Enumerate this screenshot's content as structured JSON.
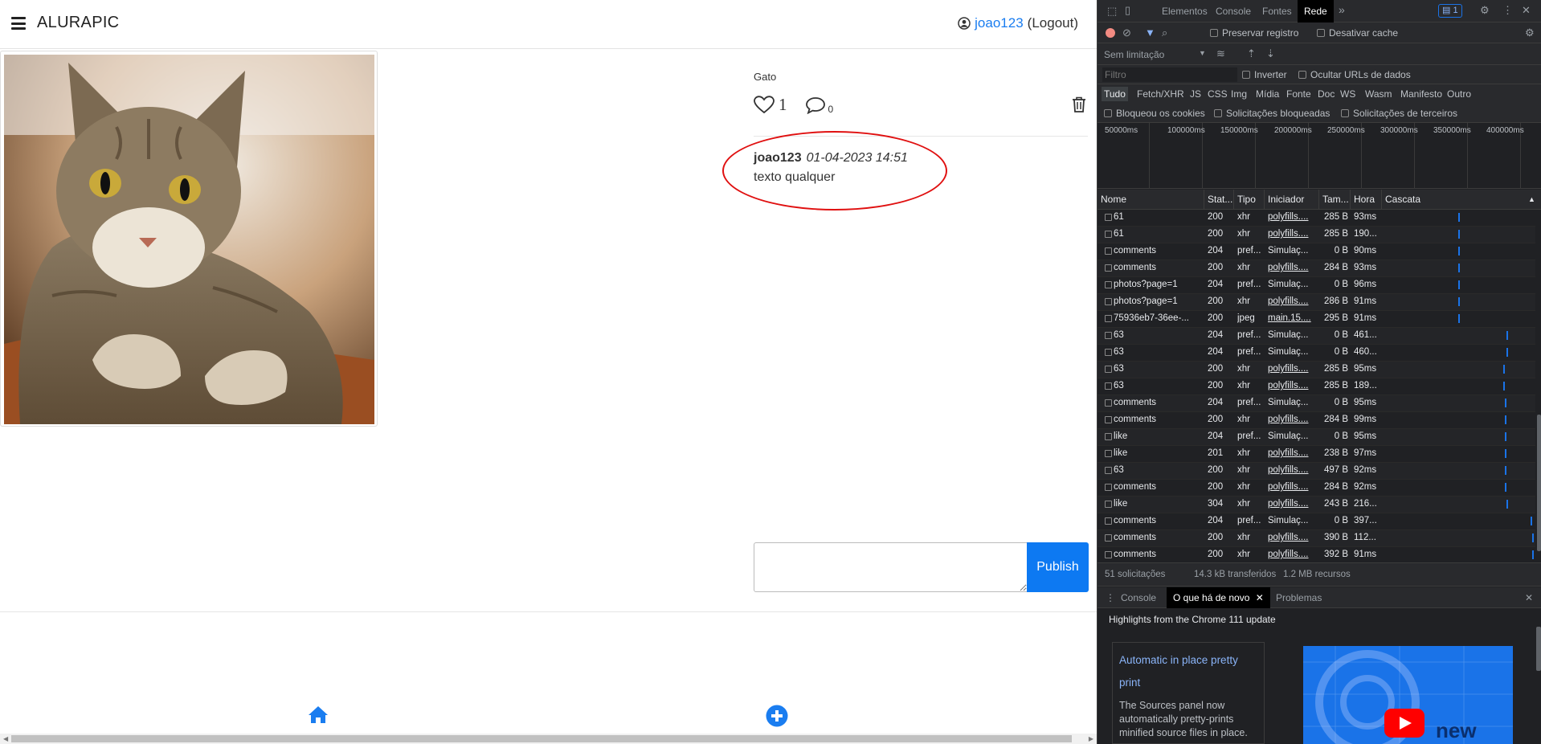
{
  "app": {
    "brand": "ALURAPIC",
    "user": {
      "username": "joao123",
      "logout_label": "(Logout)"
    },
    "photo": {
      "alt": "cat photo",
      "caption": "Gato",
      "likes": "1",
      "comments_count": "0"
    },
    "comments": [
      {
        "user": "joao123",
        "date": "01-04-2023 14:51",
        "text": "texto qualquer"
      }
    ],
    "comment_form": {
      "placeholder": "",
      "publish_label": "Publish"
    },
    "accent_color": "#0d79f2",
    "annotation_color": "#e01010"
  },
  "devtools": {
    "tabs": [
      "Elementos",
      "Console",
      "Fontes",
      "Rede"
    ],
    "active_tab": "Rede",
    "more_tabs": "»",
    "issues_badge": "1",
    "toolbar": {
      "preserve_log": "Preservar registro",
      "disable_cache": "Desativar cache",
      "throttling": "Sem limitação"
    },
    "filter": {
      "placeholder": "Filtro",
      "invert": "Inverter",
      "hide_data_urls": "Ocultar URLs de dados"
    },
    "types": [
      "Tudo",
      "Fetch/XHR",
      "JS",
      "CSS",
      "Img",
      "Mídia",
      "Fonte",
      "Doc",
      "WS",
      "Wasm",
      "Manifesto",
      "Outro"
    ],
    "blocks": {
      "blocked_cookies": "Bloqueou os cookies",
      "blocked_requests": "Solicitações bloqueadas",
      "third_party": "Solicitações de terceiros"
    },
    "timeline_ticks": [
      "50000ms",
      "100000ms",
      "150000ms",
      "200000ms",
      "250000ms",
      "300000ms",
      "350000ms",
      "400000ms"
    ],
    "columns": [
      "Nome",
      "Stat...",
      "Tipo",
      "Iniciador",
      "Tam...",
      "Hora",
      "Cascata"
    ],
    "rows": [
      {
        "name": "61",
        "status": "200",
        "type": "xhr",
        "init": "polyfills....",
        "size": "285 B",
        "time": "93ms",
        "wf": 0.5
      },
      {
        "name": "61",
        "status": "200",
        "type": "xhr",
        "init": "polyfills....",
        "size": "285 B",
        "time": "190...",
        "wf": 0.5
      },
      {
        "name": "comments",
        "status": "204",
        "type": "pref...",
        "init": "Simulaç...",
        "size": "0 B",
        "time": "90ms",
        "wf": 0.5
      },
      {
        "name": "comments",
        "status": "200",
        "type": "xhr",
        "init": "polyfills....",
        "size": "284 B",
        "time": "93ms",
        "wf": 0.5
      },
      {
        "name": "photos?page=1",
        "status": "204",
        "type": "pref...",
        "init": "Simulaç...",
        "size": "0 B",
        "time": "96ms",
        "wf": 0.5
      },
      {
        "name": "photos?page=1",
        "status": "200",
        "type": "xhr",
        "init": "polyfills....",
        "size": "286 B",
        "time": "91ms",
        "wf": 0.5
      },
      {
        "name": "75936eb7-36ee-...",
        "status": "200",
        "type": "jpeg",
        "init": "main.15....",
        "size": "295 B",
        "time": "91ms",
        "wf": 0.5
      },
      {
        "name": "63",
        "status": "204",
        "type": "pref...",
        "init": "Simulaç...",
        "size": "0 B",
        "time": "461...",
        "wf": 0.82
      },
      {
        "name": "63",
        "status": "204",
        "type": "pref...",
        "init": "Simulaç...",
        "size": "0 B",
        "time": "460...",
        "wf": 0.82
      },
      {
        "name": "63",
        "status": "200",
        "type": "xhr",
        "init": "polyfills....",
        "size": "285 B",
        "time": "95ms",
        "wf": 0.8
      },
      {
        "name": "63",
        "status": "200",
        "type": "xhr",
        "init": "polyfills....",
        "size": "285 B",
        "time": "189...",
        "wf": 0.8
      },
      {
        "name": "comments",
        "status": "204",
        "type": "pref...",
        "init": "Simulaç...",
        "size": "0 B",
        "time": "95ms",
        "wf": 0.81
      },
      {
        "name": "comments",
        "status": "200",
        "type": "xhr",
        "init": "polyfills....",
        "size": "284 B",
        "time": "99ms",
        "wf": 0.81
      },
      {
        "name": "like",
        "status": "204",
        "type": "pref...",
        "init": "Simulaç...",
        "size": "0 B",
        "time": "95ms",
        "wf": 0.81
      },
      {
        "name": "like",
        "status": "201",
        "type": "xhr",
        "init": "polyfills....",
        "size": "238 B",
        "time": "97ms",
        "wf": 0.81
      },
      {
        "name": "63",
        "status": "200",
        "type": "xhr",
        "init": "polyfills....",
        "size": "497 B",
        "time": "92ms",
        "wf": 0.81
      },
      {
        "name": "comments",
        "status": "200",
        "type": "xhr",
        "init": "polyfills....",
        "size": "284 B",
        "time": "92ms",
        "wf": 0.81
      },
      {
        "name": "like",
        "status": "304",
        "type": "xhr",
        "init": "polyfills....",
        "size": "243 B",
        "time": "216...",
        "wf": 0.82
      },
      {
        "name": "comments",
        "status": "204",
        "type": "pref...",
        "init": "Simulaç...",
        "size": "0 B",
        "time": "397...",
        "wf": 0.98
      },
      {
        "name": "comments",
        "status": "200",
        "type": "xhr",
        "init": "polyfills....",
        "size": "390 B",
        "time": "112...",
        "wf": 0.99
      },
      {
        "name": "comments",
        "status": "200",
        "type": "xhr",
        "init": "polyfills....",
        "size": "392 B",
        "time": "91ms",
        "wf": 0.99
      }
    ],
    "status_bar": {
      "requests": "51 solicitações",
      "transferred": "14.3 kB transferidos",
      "resources": "1.2 MB recursos"
    },
    "drawer": {
      "tabs": [
        "Console",
        "O que há de novo",
        "Problemas"
      ],
      "active": "O que há de novo",
      "highlight": "Highlights from the Chrome 111 update",
      "card_title": "Automatic in place pretty print",
      "card_text": "The Sources panel now automatically pretty-prints minified source files in place.",
      "promo_label": "new"
    }
  }
}
